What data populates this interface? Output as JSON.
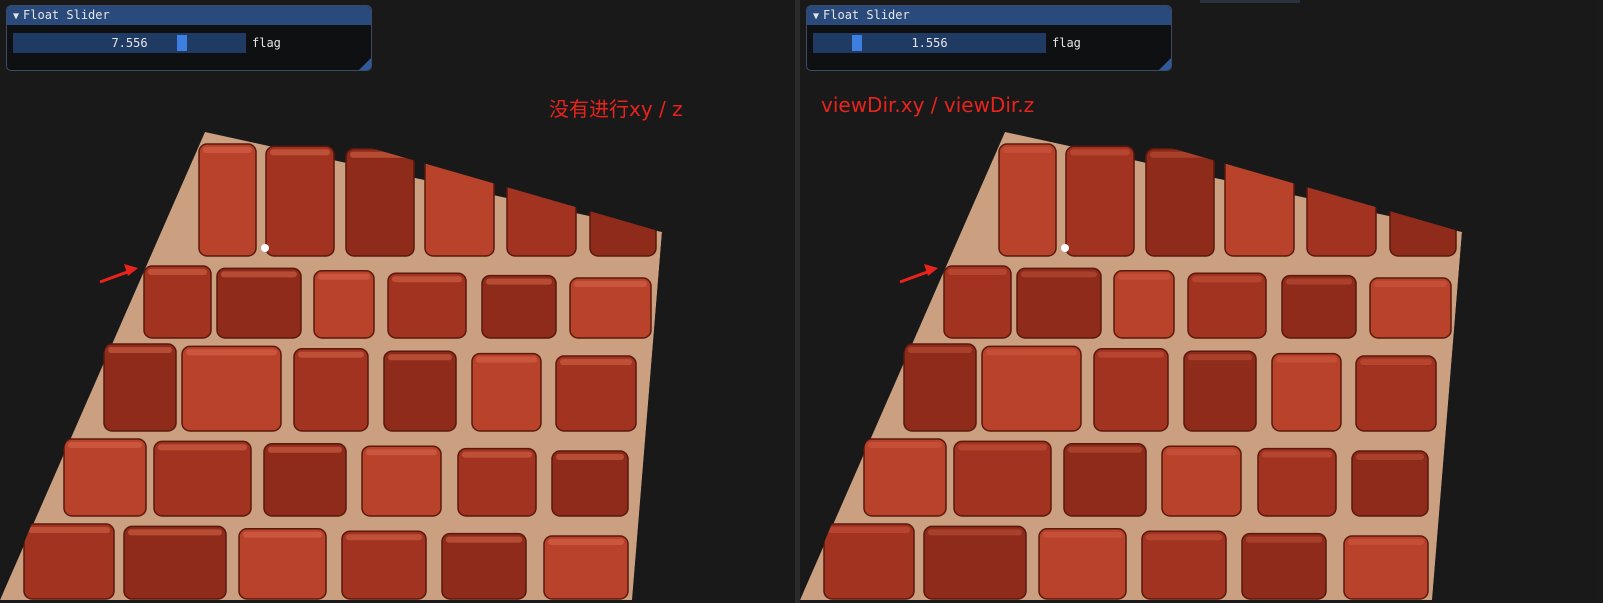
{
  "panels": [
    {
      "window_title": "Float Slider",
      "slider_value_text": "7.556",
      "slider_fraction": 0.74,
      "slider_label": "flag",
      "annotation": "没有进行xy / z"
    },
    {
      "window_title": "Float Slider",
      "slider_value_text": "1.556",
      "slider_fraction": 0.17,
      "slider_label": "flag",
      "annotation": "viewDir.xy / viewDir.z"
    }
  ],
  "colors": {
    "annotation": "#e8231c",
    "brick": "#a8341f",
    "mortar": "#c79a7c",
    "slider_grab": "#3d7fe0"
  },
  "icons": [
    "collapse-triangle-icon",
    "red-arrow-icon",
    "white-dot-icon"
  ]
}
